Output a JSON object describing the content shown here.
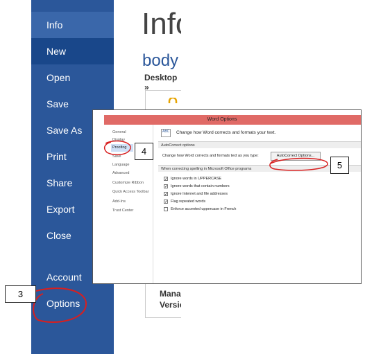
{
  "sidebar": {
    "items": [
      {
        "label": "Info"
      },
      {
        "label": "New"
      },
      {
        "label": "Open"
      },
      {
        "label": "Save"
      },
      {
        "label": "Save As"
      },
      {
        "label": "Print"
      },
      {
        "label": "Share"
      },
      {
        "label": "Export"
      },
      {
        "label": "Close"
      },
      {
        "label": "Account"
      },
      {
        "label": "Options"
      }
    ]
  },
  "main": {
    "title": "Info",
    "doc_name": "body",
    "path": "Desktop »",
    "manage_line1": "Mana",
    "manage_line2": "Versio"
  },
  "dialog": {
    "title": "Word Options",
    "categories": [
      "General",
      "Display",
      "Proofing",
      "Save",
      "Language",
      "Advanced",
      "Customize Ribbon",
      "Quick Access Toolbar",
      "Add-Ins",
      "Trust Center"
    ],
    "abc_icon_text": "ABC",
    "header_text": "Change how Word corrects and formats your text.",
    "section1": "AutoCorrect options",
    "autocorrect_row": "Change how Word corrects and formats text as you type:",
    "autocorrect_button": "AutoCorrect Options...",
    "section2": "When correcting spelling in Microsoft Office programs",
    "checks": [
      {
        "label": "Ignore words in UPPERCASE",
        "checked": true
      },
      {
        "label": "Ignore words that contain numbers",
        "checked": true
      },
      {
        "label": "Ignore Internet and file addresses",
        "checked": true
      },
      {
        "label": "Flag repeated words",
        "checked": true
      },
      {
        "label": "Enforce accented uppercase in French",
        "checked": false
      }
    ]
  },
  "callouts": {
    "c3": "3",
    "c4": "4",
    "c5": "5"
  },
  "colors": {
    "sidebar": "#2b579a",
    "sidebar_active": "#19478a",
    "title_bar": "#e06a66",
    "annotation_red": "#d81f1f"
  }
}
